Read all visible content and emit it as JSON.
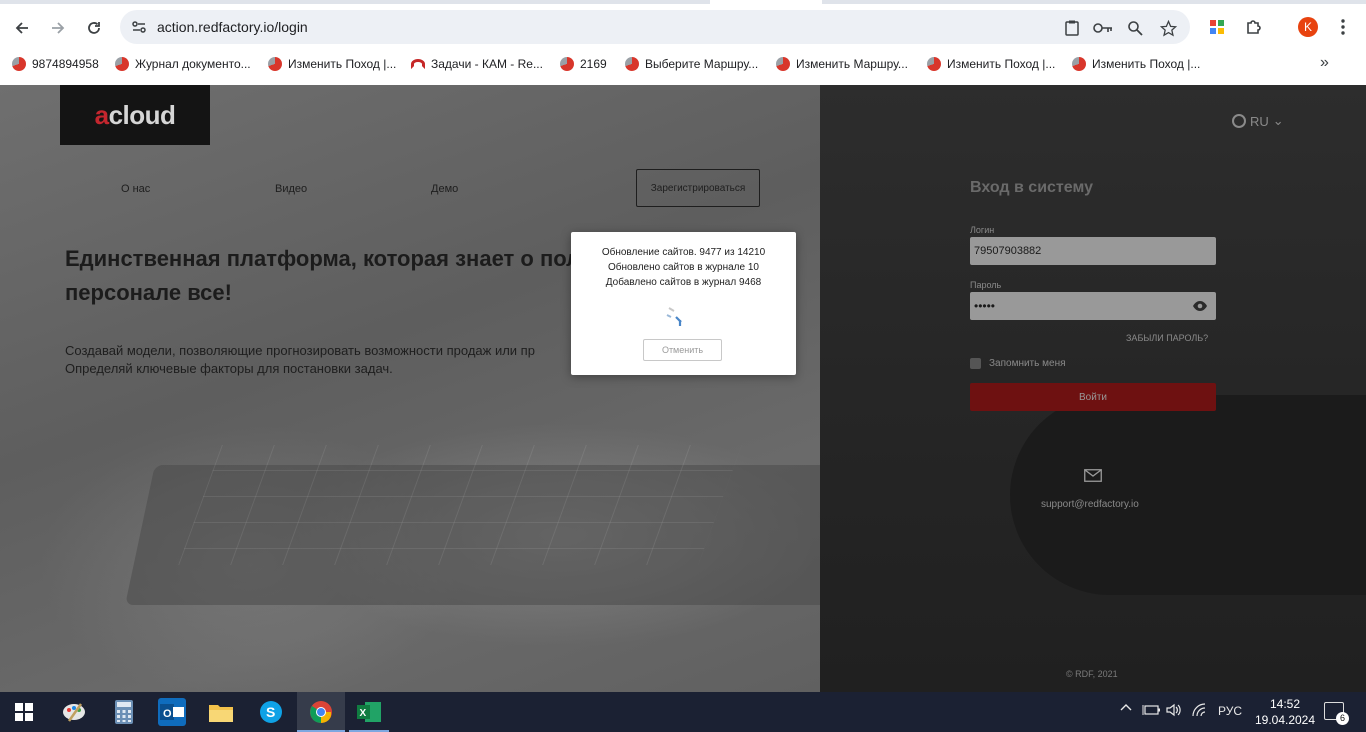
{
  "browser": {
    "url": "action.redfactory.io/login",
    "avatar_letter": "K",
    "bookmarks": [
      "9874894958",
      "Журнал документо...",
      "Изменить Поход |...",
      "Задачи - КАМ - Re...",
      "2169",
      "Выберите Маршру...",
      "Изменить Маршру...",
      "Изменить Поход |...",
      "Изменить Поход |..."
    ],
    "more_glyph": "»"
  },
  "site": {
    "logo": {
      "accent": "a",
      "rest": "cloud"
    },
    "nav": [
      "О нас",
      "Видео",
      "Демо"
    ],
    "register_label": "Зарегистрироваться",
    "headline": "Единственная платформа, которая знает о полевом персонале все!",
    "description_line1": "Создавай модели, позволяющие прогнозировать возможности продаж или пр",
    "description_line2": "Определяй ключевые факторы для постановки задач.",
    "lang": "RU",
    "lang_chevron": "⌄"
  },
  "login": {
    "title": "Вход в систему",
    "login_label": "Логин",
    "login_value": "79507903882",
    "password_label": "Пароль",
    "password_value": "•••••",
    "forgot_label": "ЗАБЫЛИ ПАРОЛЬ?",
    "remember_label": "Запомнить меня",
    "submit_label": "Войти",
    "support_email": "support@redfactory.io",
    "copyright": "© RDF, 2021"
  },
  "modal": {
    "line1": "Обновление сайтов. 9477 из 14210",
    "line2": "Обновлено сайтов в журнале 10",
    "line3": "Добавлено сайтов в журнал 9468",
    "cancel_label": "Отменить"
  },
  "taskbar": {
    "lang": "РУС",
    "time": "14:52",
    "date": "19.04.2024",
    "notifications": "6"
  },
  "colors": {
    "brand_red": "#c4262e",
    "submit_red": "#6e1111",
    "avatar": "#e8430f"
  }
}
